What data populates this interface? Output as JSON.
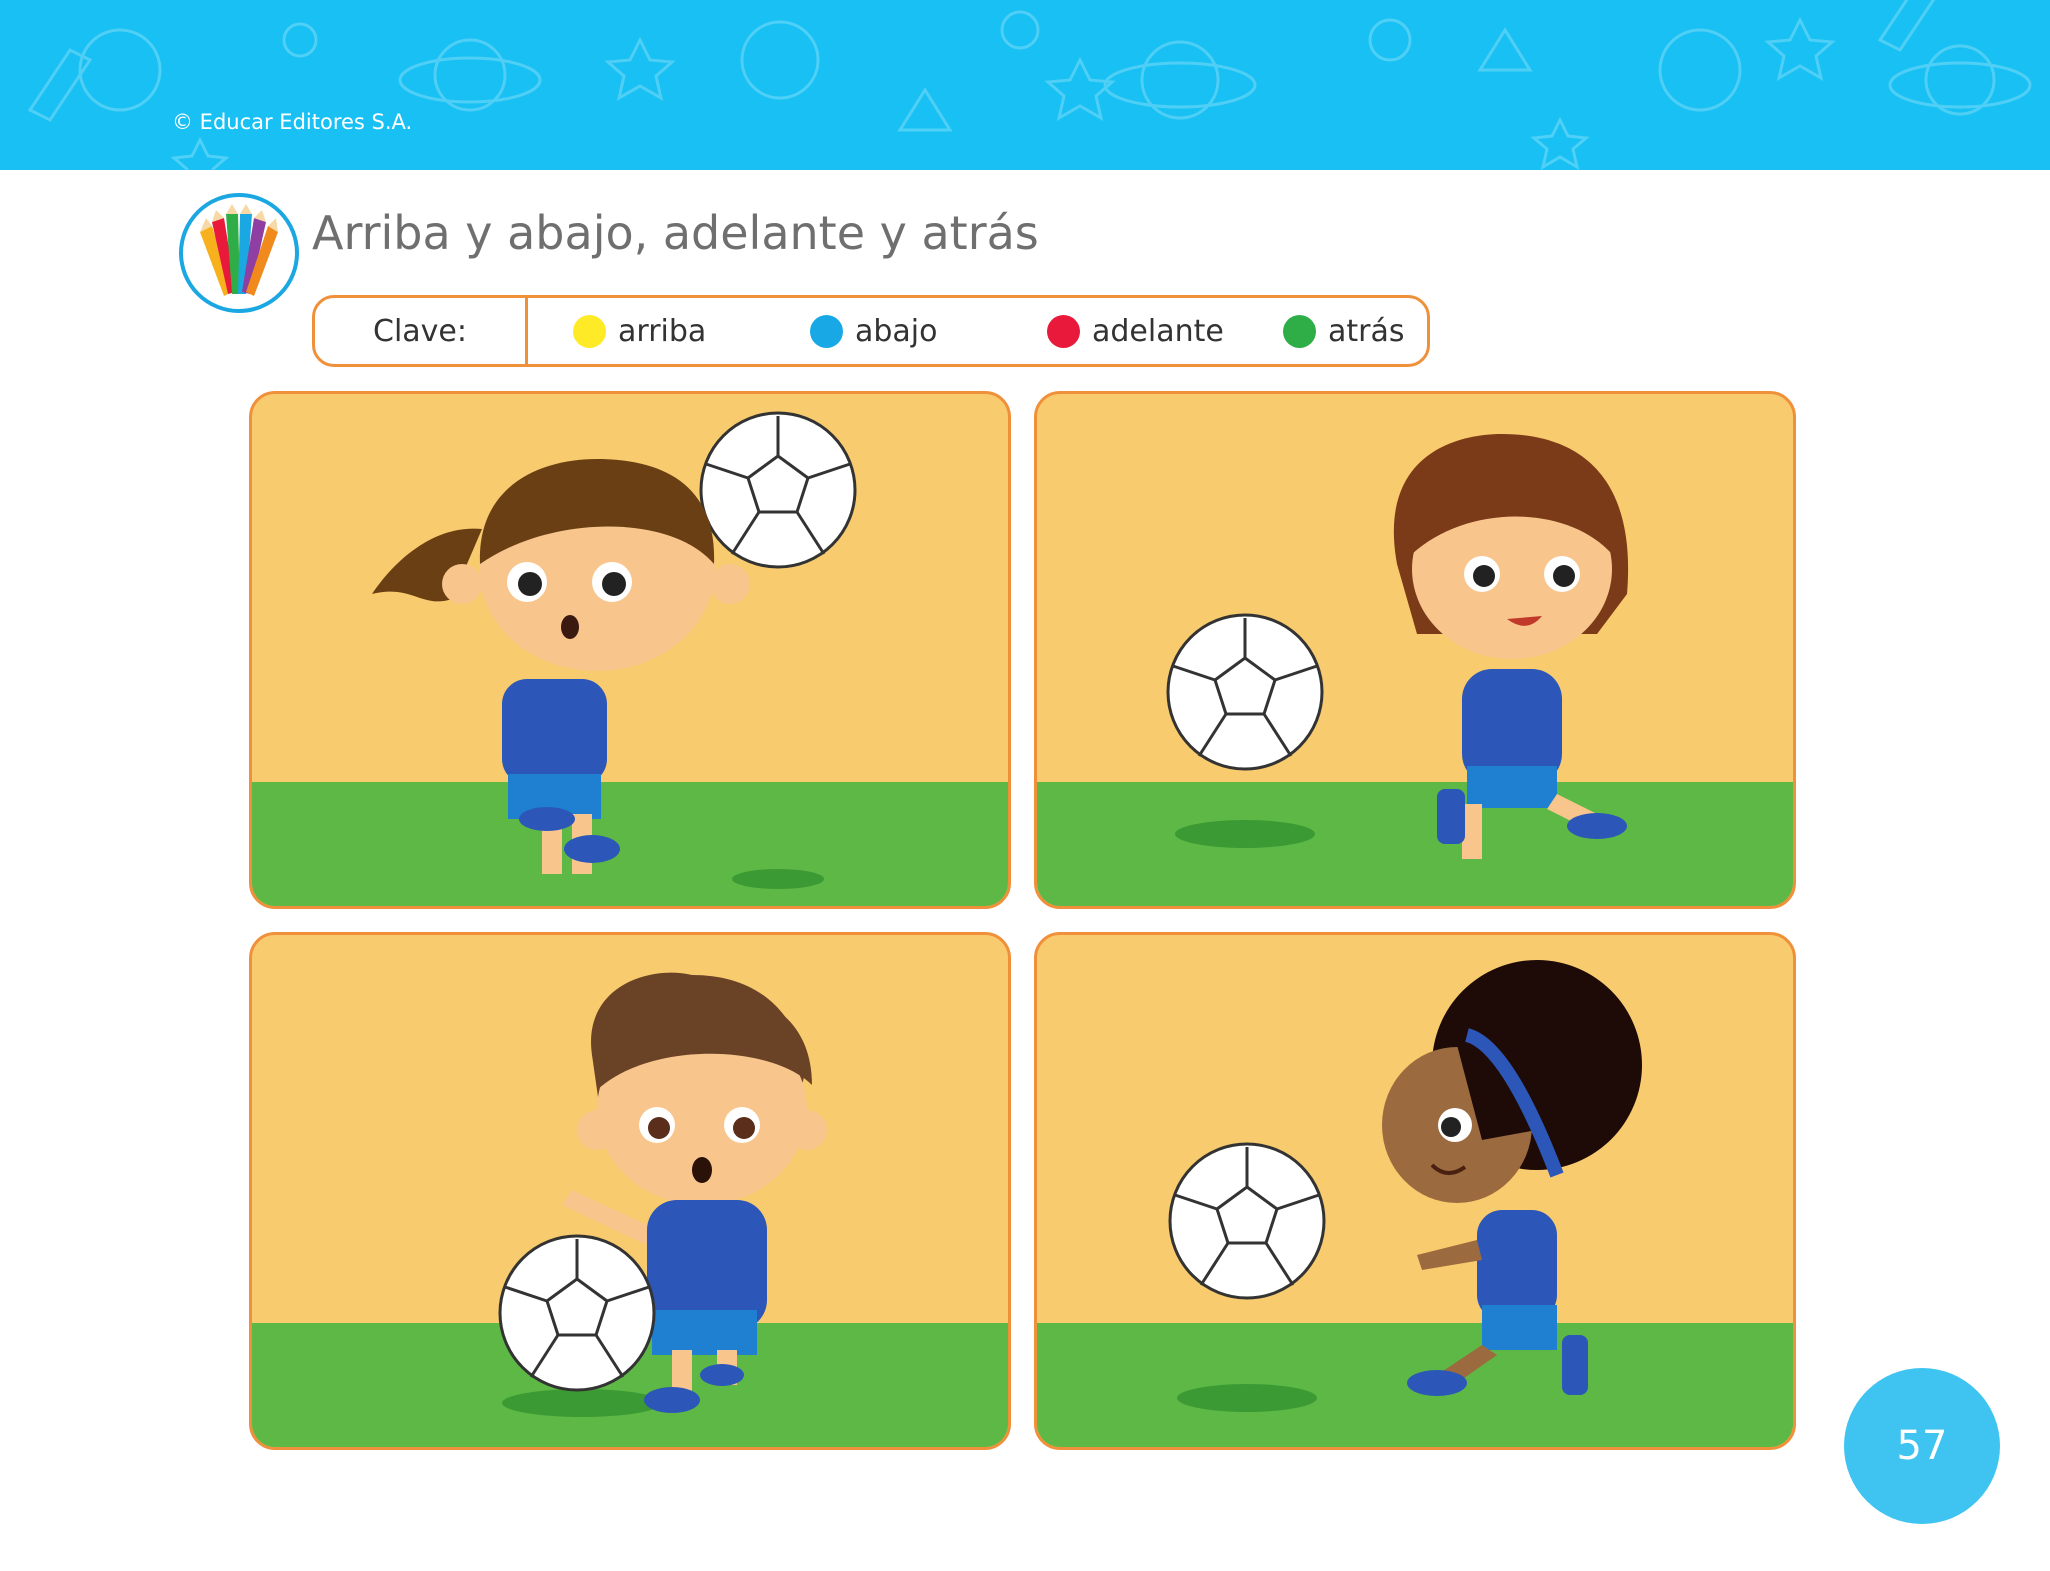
{
  "header": {
    "copyright": "© Educar Editores S.A.",
    "banner_color": "#19c0f3"
  },
  "activity": {
    "icon": "colored-pencils-icon",
    "title": "Arriba y abajo, adelante y atrás"
  },
  "key": {
    "label": "Clave:",
    "items": [
      {
        "label": "arriba",
        "color": "#ffea27"
      },
      {
        "label": "abajo",
        "color": "#18a8e6"
      },
      {
        "label": "adelante",
        "color": "#e8193b"
      },
      {
        "label": "atrás",
        "color": "#2fae48"
      }
    ]
  },
  "scenes": [
    {
      "name": "girl-ponytail-ball-above"
    },
    {
      "name": "girl-brown-hair-ball-behind"
    },
    {
      "name": "boy-ball-on-ground"
    },
    {
      "name": "girl-curly-hair-ball-ahead"
    }
  ],
  "footer": {
    "page_number": "57",
    "page_badge_color": "#3fc4f1"
  }
}
